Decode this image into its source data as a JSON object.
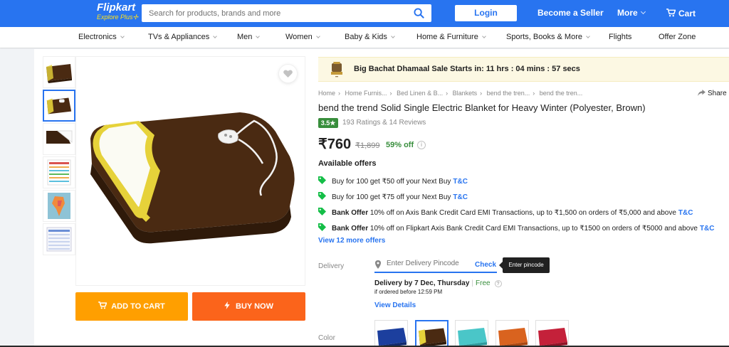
{
  "header": {
    "brand": "Flipkart",
    "tagline": "Explore",
    "tagline_plus": "Plus",
    "search_placeholder": "Search for products, brands and more",
    "login_label": "Login",
    "seller_label": "Become a Seller",
    "more_label": "More",
    "cart_label": "Cart",
    "brand_color": "#2874f0",
    "accent_color": "#ffe11b"
  },
  "categories": [
    "Electronics",
    "TVs & Appliances",
    "Men",
    "Women",
    "Baby & Kids",
    "Home & Furniture",
    "Sports, Books & More",
    "Flights",
    "Offer Zone"
  ],
  "gallery": {
    "thumb_icons": [
      "blanket-folded-thumb",
      "blanket-controller-thumb",
      "blanket-corner-thumb",
      "size-chart-thumb",
      "india-map-thumb",
      "spec-table-thumb"
    ],
    "selected_index": 1,
    "wishlist_icon": "heart-icon"
  },
  "actions": {
    "add_to_cart": "ADD TO CART",
    "buy_now": "BUY NOW",
    "cart_color": "#ff9f00",
    "buy_color": "#fb641b"
  },
  "sale": {
    "text": "Big Bachat Dhamaal Sale Starts in: 11 hrs : 04 mins : 57 secs"
  },
  "breadcrumbs": [
    "Home",
    "Home Furnis...",
    "Bed Linen & B...",
    "Blankets",
    "bend the tren...",
    "bend the tren..."
  ],
  "share_label": "Share",
  "product": {
    "title": "bend the trend Solid Single Electric Blanket for Heavy Winter  (Polyester, Brown)",
    "rating": "3.5★",
    "ratings_reviews": "193 Ratings & 14 Reviews",
    "price": "₹760",
    "mrp": "₹1,899",
    "discount": "59% off"
  },
  "offers": {
    "heading": "Available offers",
    "items": [
      {
        "bold": "",
        "text": "Buy for 100 get ₹50 off your Next Buy",
        "link": "T&C"
      },
      {
        "bold": "",
        "text": "Buy for 100 get ₹75 off your Next Buy",
        "link": "T&C"
      },
      {
        "bold": "Bank Offer",
        "text": "10% off on Axis Bank Credit Card EMI Transactions, up to ₹1,500 on orders of ₹5,000 and above",
        "link": "T&C"
      },
      {
        "bold": "Bank Offer",
        "text": "10% off on Flipkart Axis Bank Credit Card EMI Transactions, up to ₹1500 on orders of ₹5000 and above",
        "link": "T&C"
      }
    ],
    "more_label": "View 12 more offers"
  },
  "delivery": {
    "label": "Delivery",
    "pincode_placeholder": "Enter Delivery Pincode",
    "check_label": "Check",
    "tooltip": "Enter pincode",
    "delivery_by": "Delivery by 7 Dec, Thursday",
    "separator": "|",
    "free_label": "Free",
    "help": "?",
    "order_before": "if ordered before 12:59 PM",
    "view_details": "View Details"
  },
  "color_option": {
    "label": "Color",
    "swatches": [
      {
        "name": "Blue",
        "hex": "#1c3f9e"
      },
      {
        "name": "Brown",
        "hex": "#4a2a12"
      },
      {
        "name": "Teal",
        "hex": "#4ac6c8"
      },
      {
        "name": "Orange",
        "hex": "#d9631f"
      },
      {
        "name": "Red",
        "hex": "#c4213a"
      }
    ],
    "selected_index": 1
  }
}
